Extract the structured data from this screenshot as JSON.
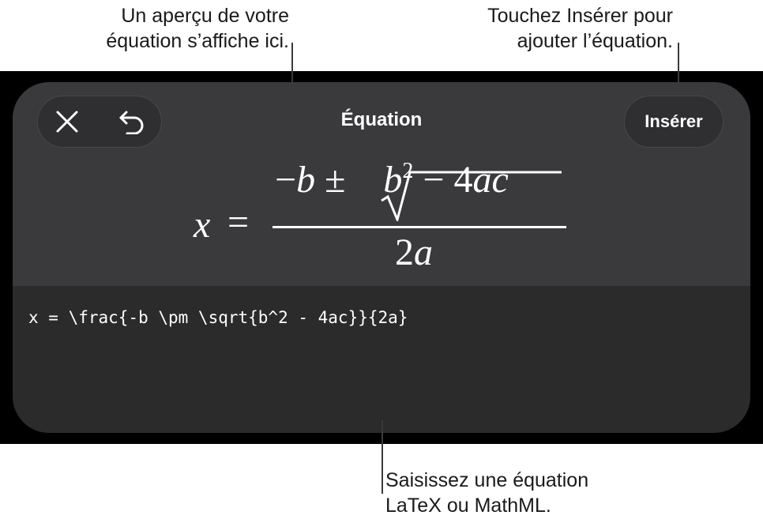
{
  "callouts": {
    "preview": [
      "Un aperçu de votre",
      "équation s’affiche ici."
    ],
    "insert": [
      "Touchez Insérer pour",
      "ajouter l’équation."
    ],
    "input": [
      "Saisissez une équation",
      "LaTeX ou MathML."
    ]
  },
  "sheet": {
    "title": "Équation",
    "insert_label": "Insérer",
    "icons": {
      "close": "close-icon",
      "undo": "undo-icon"
    }
  },
  "preview": {
    "x": "x",
    "equals": "=",
    "minus": "−",
    "b": "b",
    "pm": "±",
    "b2_base": "b",
    "b2_exp": "2",
    "minus2": "−",
    "four": "4",
    "ac": "ac",
    "den_two": "2",
    "den_a": "a"
  },
  "editor": {
    "latex": "x = \\frac{-b \\pm \\sqrt{b^2 - 4ac}}{2a}"
  },
  "colors": {
    "screen": "#000000",
    "sheet": "#2b2b2c",
    "sheet_top": "#3a3a3c",
    "text": "#ffffff"
  }
}
